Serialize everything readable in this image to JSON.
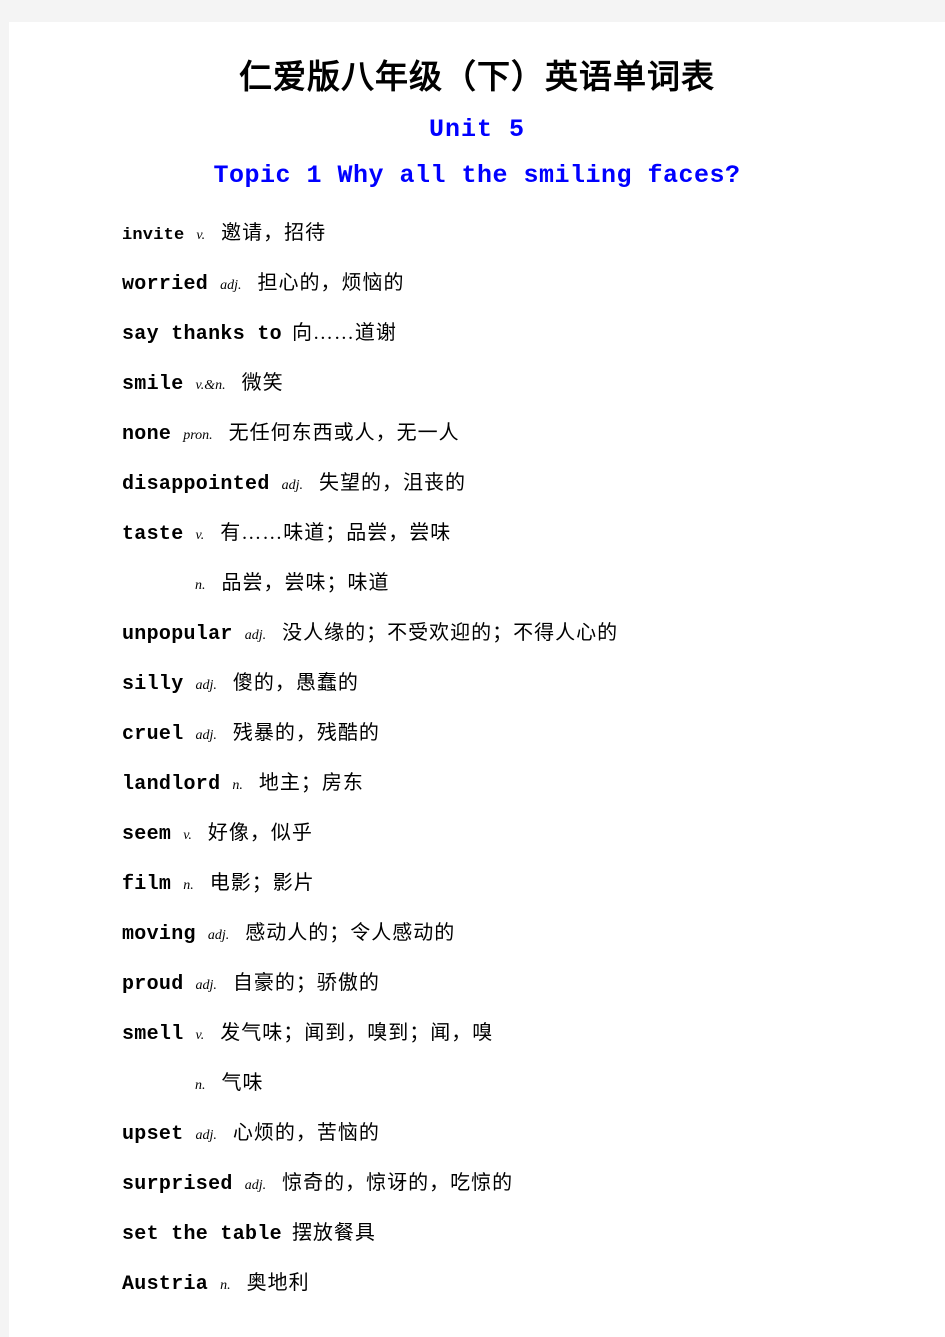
{
  "document": {
    "title": "仁爱版八年级（下）英语单词表",
    "unit": "Unit 5",
    "topic": "Topic 1  Why all the smiling faces?",
    "heading_color": "#0000ff",
    "title_color": "#000000"
  },
  "entries": [
    {
      "word": "invite",
      "pos": "v.",
      "definition": "邀请，招待",
      "continuation": false,
      "small": true
    },
    {
      "word": "worried",
      "pos": "adj.",
      "definition": "担心的，烦恼的",
      "continuation": false,
      "small": false
    },
    {
      "word": "say thanks to",
      "pos": "",
      "definition": "向……道谢",
      "continuation": false,
      "small": false
    },
    {
      "word": "smile",
      "pos": "v.&n.",
      "definition": "微笑",
      "continuation": false,
      "small": false
    },
    {
      "word": "none",
      "pos": "pron.",
      "definition": "无任何东西或人，无一人",
      "continuation": false,
      "small": false
    },
    {
      "word": "disappointed",
      "pos": "adj.",
      "definition": "失望的，沮丧的",
      "continuation": false,
      "small": false
    },
    {
      "word": "taste",
      "pos": "v.",
      "definition": "有……味道；品尝，尝味",
      "continuation": false,
      "small": false
    },
    {
      "word": "",
      "pos": "n.",
      "definition": "品尝，尝味；味道",
      "continuation": true,
      "small": false
    },
    {
      "word": "unpopular",
      "pos": "adj.",
      "definition": "没人缘的；不受欢迎的；不得人心的",
      "continuation": false,
      "small": false
    },
    {
      "word": "silly",
      "pos": "adj.",
      "definition": "傻的，愚蠢的",
      "continuation": false,
      "small": false
    },
    {
      "word": "cruel",
      "pos": "adj.",
      "definition": "残暴的，残酷的",
      "continuation": false,
      "small": false
    },
    {
      "word": "landlord",
      "pos": "n.",
      "definition": "地主；房东",
      "continuation": false,
      "small": false
    },
    {
      "word": "seem",
      "pos": "v.",
      "definition": "好像，似乎",
      "continuation": false,
      "small": false
    },
    {
      "word": "film",
      "pos": "n.",
      "definition": "电影；影片",
      "continuation": false,
      "small": false
    },
    {
      "word": "moving",
      "pos": "adj.",
      "definition": "感动人的；令人感动的",
      "continuation": false,
      "small": false
    },
    {
      "word": "proud",
      "pos": "adj.",
      "definition": "自豪的；骄傲的",
      "continuation": false,
      "small": false
    },
    {
      "word": "smell",
      "pos": "v.",
      "definition": "发气味；闻到，嗅到；闻，嗅",
      "continuation": false,
      "small": false
    },
    {
      "word": "",
      "pos": "n.",
      "definition": "气味",
      "continuation": true,
      "small": false
    },
    {
      "word": "upset",
      "pos": "adj.",
      "definition": "心烦的，苦恼的",
      "continuation": false,
      "small": false
    },
    {
      "word": "surprised",
      "pos": "adj.",
      "definition": "惊奇的，惊讶的，吃惊的",
      "continuation": false,
      "small": false
    },
    {
      "word": "set the table",
      "pos": "",
      "definition": "摆放餐具",
      "continuation": false,
      "small": false
    },
    {
      "word": "Austria",
      "pos": "n.",
      "definition": "奥地利",
      "continuation": false,
      "small": false
    }
  ]
}
